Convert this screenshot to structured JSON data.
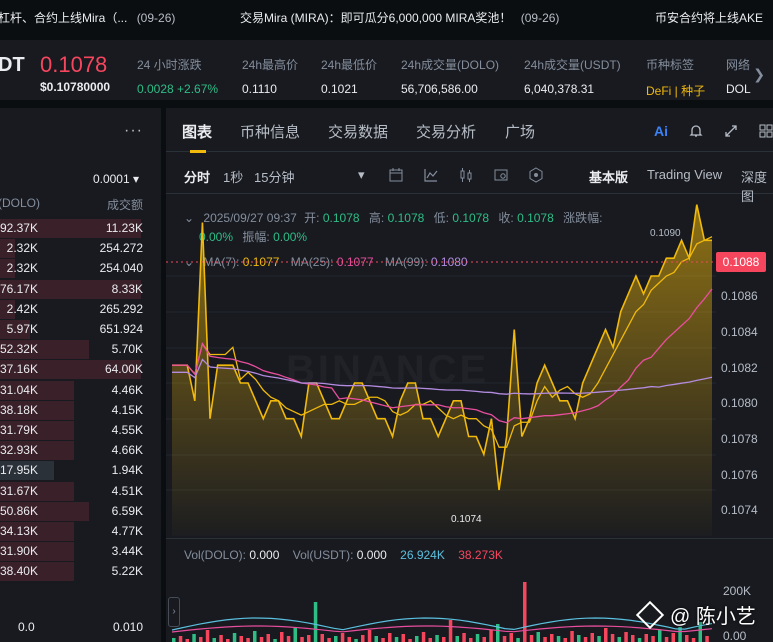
{
  "ticker": [
    {
      "text": "杠杆、合约上线Mira（...",
      "date": "(09-26)"
    },
    {
      "text": "交易Mira (MIRA)：即可瓜分6,000,000 MIRA奖池！",
      "date": "(09-26)"
    },
    {
      "text": "币安合约将上线AKE",
      "date": ""
    }
  ],
  "header": {
    "pair": "DT",
    "price": "0.1078",
    "price_usd": "$0.10780000",
    "stats": [
      {
        "label": "24 小时涨跌",
        "value": "0.0028 +2.67%"
      },
      {
        "label": "24h最高价",
        "value": "0.1110"
      },
      {
        "label": "24h最低价",
        "value": "0.1021"
      },
      {
        "label": "24h成交量(DOLO)",
        "value": "56,706,586.00"
      },
      {
        "label": "24h成交量(USDT)",
        "value": "6,040,378.31"
      },
      {
        "label": "币种标签",
        "value": "DeFi | 种子"
      },
      {
        "label": "网络",
        "value": "DOL"
      }
    ]
  },
  "left_panel": {
    "menu": "···",
    "step": "0.0001 ▾",
    "col_qty": "(DOLO)",
    "col_total": "成交额",
    "rows": [
      {
        "qty": "92.37K",
        "total": "11.23K",
        "fill": 0.95
      },
      {
        "qty": "2.32K",
        "total": "254.272",
        "fill": 0.1
      },
      {
        "qty": "2.32K",
        "total": "254.040",
        "fill": 0.1
      },
      {
        "qty": "76.17K",
        "total": "8.33K",
        "fill": 0.95
      },
      {
        "qty": "2.42K",
        "total": "265.292",
        "fill": 0.1
      },
      {
        "qty": "5.97K",
        "total": "651.924",
        "fill": 0.2
      },
      {
        "qty": "52.32K",
        "total": "5.70K",
        "fill": 0.6
      },
      {
        "qty": "37.16K",
        "total": "64.00K",
        "fill": 0.95
      },
      {
        "qty": "31.04K",
        "total": "4.46K",
        "fill": 0.5
      },
      {
        "qty": "38.18K",
        "total": "4.15K",
        "fill": 0.5
      },
      {
        "qty": "31.79K",
        "total": "4.55K",
        "fill": 0.5
      },
      {
        "qty": "32.93K",
        "total": "4.66K",
        "fill": 0.5
      },
      {
        "qty": "17.95K",
        "total": "1.94K",
        "fill": 0.0
      },
      {
        "qty": "31.67K",
        "total": "4.51K",
        "fill": 0.5
      },
      {
        "qty": "50.86K",
        "total": "6.59K",
        "fill": 0.6
      },
      {
        "qty": "34.13K",
        "total": "4.77K",
        "fill": 0.5
      },
      {
        "qty": "31.90K",
        "total": "3.44K",
        "fill": 0.5
      },
      {
        "qty": "38.40K",
        "total": "5.22K",
        "fill": 0.5
      }
    ],
    "footer_qty": "0.0",
    "footer_total": "0.010"
  },
  "tabs": [
    "图表",
    "币种信息",
    "交易数据",
    "交易分析",
    "广场"
  ],
  "toolbar": {
    "time": "分时",
    "s1": "1秒",
    "m15": "15分钟",
    "more": "▾",
    "basic": "基本版",
    "tv": "Trading View",
    "depth": "深度图"
  },
  "info": {
    "datetime": "2025/09/27 09:37",
    "open_label": "开:",
    "open": "0.1078",
    "high_label": "高:",
    "high": "0.1078",
    "low_label": "低:",
    "low": "0.1078",
    "close_label": "收:",
    "close": "0.1078",
    "chg_label": "涨跌幅:",
    "chg": "0.00%",
    "amp_label": "振幅:",
    "amp": "0.00%",
    "ma7_label": "MA(7):",
    "ma7": "0.1077",
    "ma25_label": "MA(25):",
    "ma25": "0.1077",
    "ma99_label": "MA(99):",
    "ma99": "0.1080"
  },
  "price_axis": {
    "current": "0.1088",
    "ticks": [
      "0.1086",
      "0.1084",
      "0.1082",
      "0.1080",
      "0.1078",
      "0.1076",
      "0.1074"
    ],
    "high_label": "0.1090",
    "low_label": "0.1074"
  },
  "volume": {
    "vol_dolo_label": "Vol(DOLO):",
    "vol_dolo": "0.000",
    "vol_usdt_label": "Vol(USDT):",
    "vol_usdt": "0.000",
    "ma_a": "26.924K",
    "ma_b": "38.273K",
    "axis_top": "200K",
    "axis_bottom": "0.00"
  },
  "watermark": "@ 陈小艺",
  "chart_wm": "BINANCE",
  "chart_data": {
    "type": "line",
    "price_series": [
      1.0081,
      1.0081,
      1.0081,
      1.0079,
      1.0089,
      1.0078,
      1.0081,
      1.0081,
      1.0081,
      1.008,
      1.008,
      1.0079,
      1.0078,
      1.0079,
      1.0079,
      1.0078,
      1.0078,
      1.0077,
      1.008,
      1.008,
      1.0079,
      1.0078,
      1.0078,
      1.0079,
      1.008,
      1.008,
      1.0079,
      1.0078,
      1.0078,
      1.0077,
      1.0079,
      1.008,
      1.008,
      1.0078,
      1.0078,
      1.0077,
      1.0078,
      1.0079,
      1.0079,
      1.0077,
      1.0077,
      1.0076,
      1.0078,
      1.0074,
      1.0077,
      1.0083,
      1.0077,
      1.0078,
      1.008,
      1.0081,
      1.008,
      1.0079,
      1.0079,
      1.0078,
      1.008,
      1.0081,
      1.0082,
      1.0083,
      1.0082,
      1.0084,
      1.0085,
      1.0086,
      1.0085,
      1.0086,
      1.0086,
      1.0087,
      1.0087,
      1.0088,
      1.0087,
      1.009,
      1.0088,
      1.0088
    ]
  }
}
